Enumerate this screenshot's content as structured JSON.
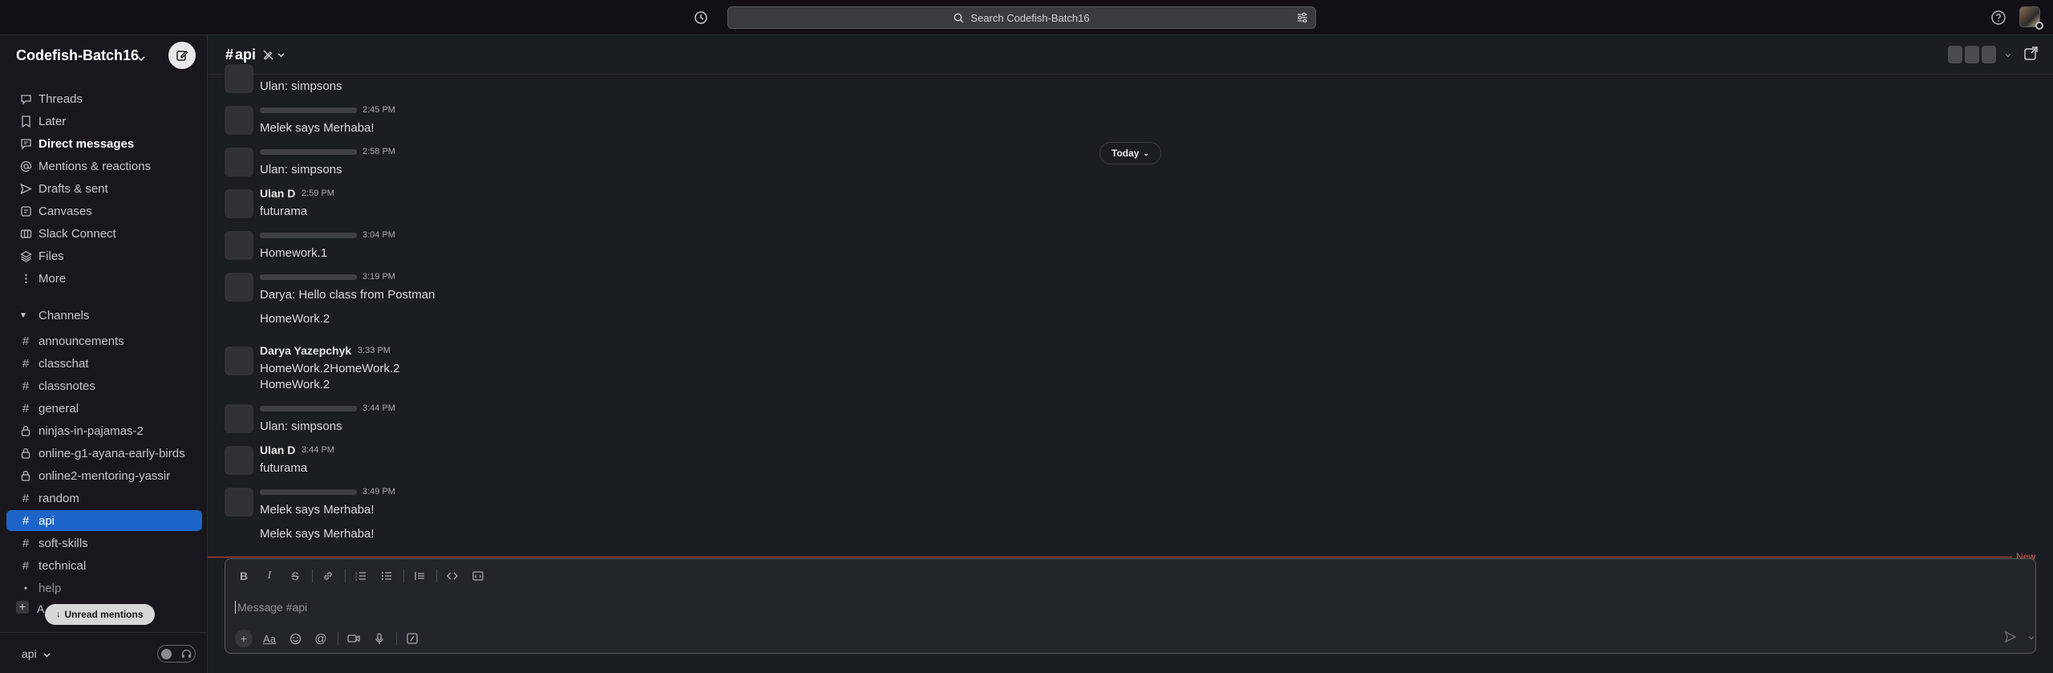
{
  "topbar": {
    "search_placeholder": "Search Codefish-Batch16"
  },
  "sidebar": {
    "workspace_name": "Codefish-Batch16",
    "nav": [
      {
        "label": "Threads",
        "icon": "threads-icon",
        "bold": false
      },
      {
        "label": "Later",
        "icon": "bookmark-icon",
        "bold": false
      },
      {
        "label": "Direct messages",
        "icon": "direct-messages-icon",
        "bold": true
      },
      {
        "label": "Mentions & reactions",
        "icon": "at-icon",
        "bold": false
      },
      {
        "label": "Drafts & sent",
        "icon": "send-icon",
        "bold": false
      },
      {
        "label": "Canvases",
        "icon": "canvas-icon",
        "bold": false
      },
      {
        "label": "Slack Connect",
        "icon": "connect-icon",
        "bold": false
      },
      {
        "label": "Files",
        "icon": "files-icon",
        "bold": false
      },
      {
        "label": "More",
        "icon": "more-icon",
        "bold": false
      }
    ],
    "channels_header": "Channels",
    "channels": [
      {
        "name": "announcements",
        "type": "public"
      },
      {
        "name": "classchat",
        "type": "public"
      },
      {
        "name": "classnotes",
        "type": "public"
      },
      {
        "name": "general",
        "type": "public"
      },
      {
        "name": "ninjas-in-pajamas-2",
        "type": "private"
      },
      {
        "name": "online-g1-ayana-early-birds",
        "type": "private"
      },
      {
        "name": "online2-mentoring-yassir",
        "type": "private"
      },
      {
        "name": "random",
        "type": "public"
      },
      {
        "name": "api",
        "type": "public",
        "active": true
      },
      {
        "name": "soft-skills",
        "type": "public"
      },
      {
        "name": "technical",
        "type": "public"
      },
      {
        "name": "help",
        "type": "sparkle"
      }
    ],
    "add_label": "A",
    "unread_mentions": "Unread mentions",
    "footer_channel": "api"
  },
  "channel": {
    "name": "api",
    "hash": "#"
  },
  "messages": [
    {
      "author": "",
      "time": "",
      "text": "Ulan: simpsons",
      "avatar": true,
      "namebar": false
    },
    {
      "author": "",
      "time": "2:45 PM",
      "text": "Melek says Merhaba!",
      "avatar": true,
      "namebar": true
    },
    {
      "author": "",
      "time": "2:58 PM",
      "text": "Ulan: simpsons",
      "avatar": true,
      "namebar": true
    },
    {
      "author": "Ulan D",
      "time": "2:59 PM",
      "text": "futurama",
      "avatar": true,
      "namebar": false
    },
    {
      "author": "",
      "time": "3:04 PM",
      "text": "Homework.1",
      "avatar": true,
      "namebar": true
    },
    {
      "author": "",
      "time": "3:19 PM",
      "text": "Darya: Hello class from Postman",
      "avatar": true,
      "namebar": true
    },
    {
      "author": "",
      "time": "",
      "text": "HomeWork.2",
      "avatar": false,
      "namebar": false
    },
    {
      "author": "Darya Yazepchyk",
      "time": "3:33 PM",
      "text": "HomeWork.2HomeWork.2",
      "avatar": true,
      "namebar": false
    },
    {
      "author": "",
      "time": "",
      "text": "HomeWork.2",
      "avatar": false,
      "namebar": false
    },
    {
      "author": "",
      "time": "3:44 PM",
      "text": "Ulan: simpsons",
      "avatar": true,
      "namebar": true
    },
    {
      "author": "Ulan D",
      "time": "3:44 PM",
      "text": "futurama",
      "avatar": true,
      "namebar": false
    },
    {
      "author": "",
      "time": "3:49 PM",
      "text": "Melek says Merhaba!",
      "avatar": true,
      "namebar": true
    },
    {
      "author": "",
      "time": "",
      "text": "Melek says Merhaba!",
      "avatar": false,
      "namebar": false
    }
  ],
  "today_label": "Today",
  "new_label": "New",
  "composer": {
    "placeholder": "Message #api"
  }
}
